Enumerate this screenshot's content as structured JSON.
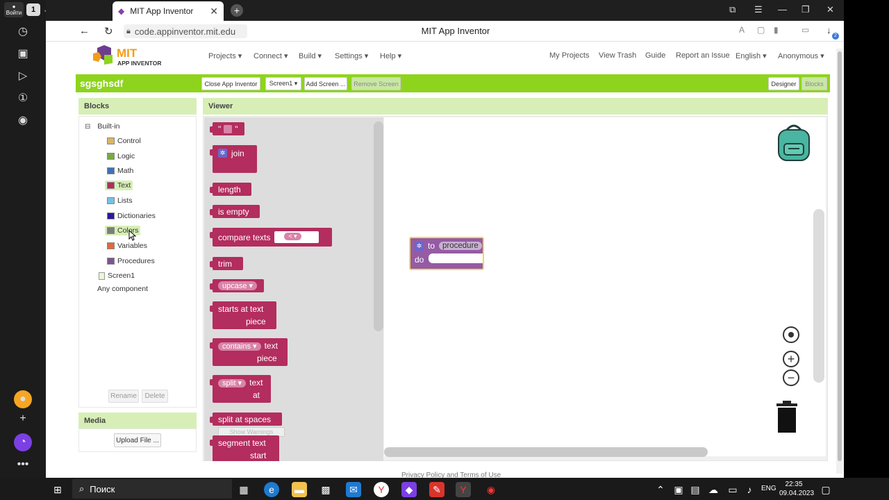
{
  "browser": {
    "login_label": "Войти",
    "tab_count": "1",
    "tab_title": "MIT App Inventor",
    "url": "code.appinventor.mit.edu",
    "page_title": "MIT App Inventor",
    "download_badge": "2"
  },
  "app": {
    "logo_title": "MIT",
    "logo_subtitle": "APP INVENTOR",
    "menu": [
      "Projects ▾",
      "Connect ▾",
      "Build ▾",
      "Settings ▾",
      "Help ▾"
    ],
    "right_menu": [
      "My Projects",
      "View Trash",
      "Guide",
      "Report an Issue",
      "English ▾",
      "Anonymous ▾"
    ],
    "project_name": "sgsghsdf",
    "toolbar": {
      "close": "Close App Inventor",
      "screen": "Screen1 ▾",
      "add_screen": "Add Screen ...",
      "remove_screen": "Remove Screen",
      "designer": "Designer",
      "blocks": "Blocks"
    },
    "blocks_panel": {
      "title": "Blocks",
      "toggle": "⊟",
      "builtin": "Built-in",
      "items": [
        {
          "label": "Control",
          "color": "#d9b565"
        },
        {
          "label": "Logic",
          "color": "#77ab41"
        },
        {
          "label": "Math",
          "color": "#3f72b5"
        },
        {
          "label": "Text",
          "color": "#b32d5e"
        },
        {
          "label": "Lists",
          "color": "#73c1e8"
        },
        {
          "label": "Dictionaries",
          "color": "#2d1799"
        },
        {
          "label": "Colors",
          "color": "#7d7d7d"
        },
        {
          "label": "Variables",
          "color": "#e5673b"
        },
        {
          "label": "Procedures",
          "color": "#7c5493"
        }
      ],
      "screen": "Screen1",
      "any_component": "Any component",
      "rename": "Rename",
      "delete": "Delete"
    },
    "media_panel": {
      "title": "Media",
      "upload": "Upload File ..."
    },
    "viewer": {
      "title": "Viewer",
      "flyout": {
        "string_quote": "\"",
        "join": "join",
        "length": "length",
        "is_empty": "is empty",
        "compare": "compare texts",
        "compare_op": "< ▾",
        "trim": "trim",
        "upcase": "upcase ▾",
        "starts_at": "starts at",
        "text": "text",
        "piece": "piece",
        "contains": "contains ▾",
        "split": "split ▾",
        "at": "at",
        "split_spaces": "split at spaces",
        "segment": "segment",
        "start": "start"
      },
      "procedure": {
        "to": "to",
        "name": "procedure",
        "do": "do"
      },
      "show_warnings": "Show Warnings"
    },
    "footer": "Privacy Policy and Terms of Use"
  },
  "taskbar": {
    "search": "Поиск",
    "lang": "ENG",
    "time": "22:35",
    "date": "09.04.2023"
  }
}
